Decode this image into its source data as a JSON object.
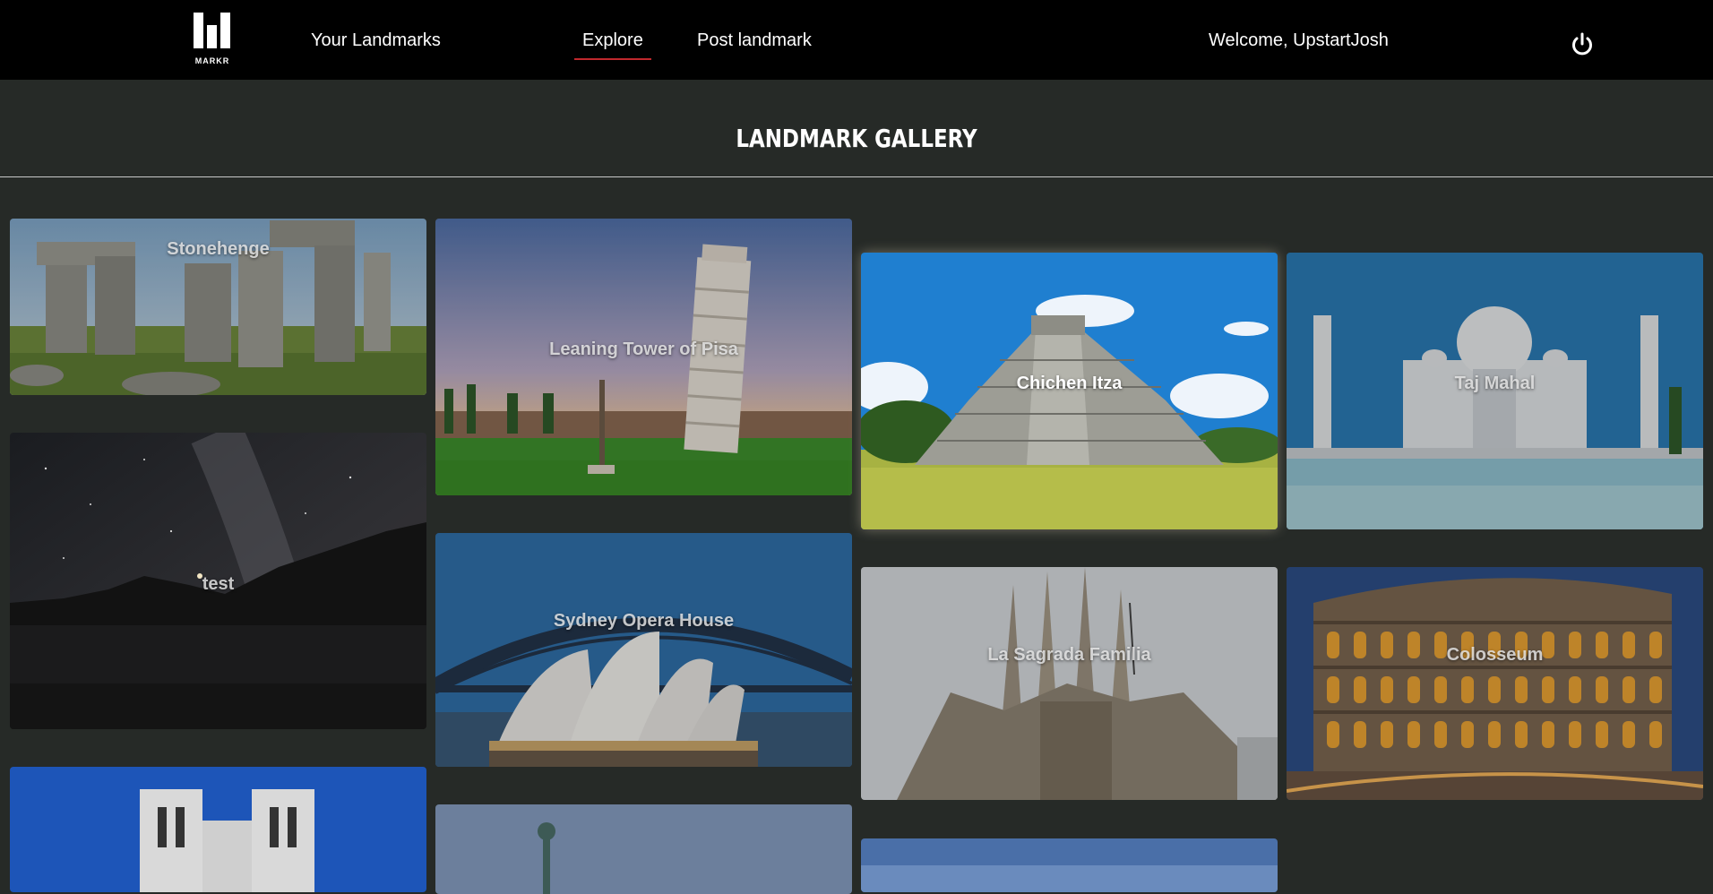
{
  "nav": {
    "logo_text": "MARKR",
    "your_landmarks": "Your Landmarks",
    "explore": "Explore",
    "post_landmark": "Post landmark",
    "welcome": "Welcome, UpstartJosh"
  },
  "gallery": {
    "title": "LANDMARK GALLERY",
    "cards": [
      {
        "label": "Stonehenge"
      },
      {
        "label": "Leaning Tower of Pisa"
      },
      {
        "label": "Chichen Itza"
      },
      {
        "label": "Taj Mahal"
      },
      {
        "label": "test"
      },
      {
        "label": "Sydney Opera House"
      },
      {
        "label": "La Sagrada Familia"
      },
      {
        "label": "Colosseum"
      }
    ]
  },
  "colors": {
    "navbar": "#000000",
    "background": "#262a27",
    "active_underline": "#c0282d"
  },
  "icons": [
    "markr-logo-icon",
    "power-icon"
  ]
}
